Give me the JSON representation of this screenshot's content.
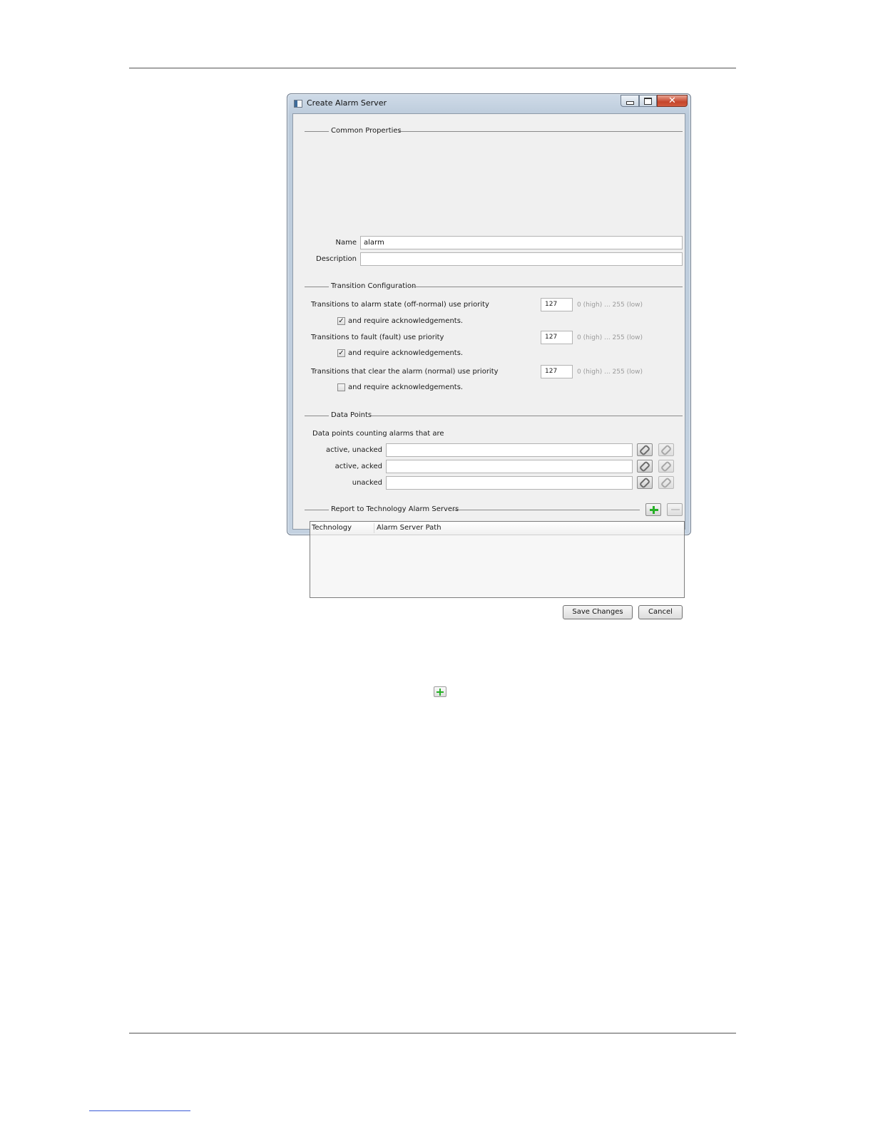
{
  "window": {
    "title": "Create Alarm Server",
    "close_glyph": "✕"
  },
  "common": {
    "heading": "Common Properties",
    "name_label": "Name",
    "name_value": "alarm",
    "description_label": "Description",
    "description_value": ""
  },
  "transition": {
    "heading": "Transition Configuration",
    "rows": [
      {
        "label": "Transitions to alarm state (off-normal) use priority",
        "priority": "127",
        "range_hint": "0 (high) ... 255 (low)",
        "ack_label": "and require acknowledgements.",
        "ack_checked": true,
        "ack_mark": "✓"
      },
      {
        "label": "Transitions to fault (fault) use priority",
        "priority": "127",
        "range_hint": "0 (high) ... 255 (low)",
        "ack_label": "and require acknowledgements.",
        "ack_checked": true,
        "ack_mark": "✓"
      },
      {
        "label": "Transitions that clear the alarm (normal) use priority",
        "priority": "127",
        "range_hint": "0 (high) ... 255 (low)",
        "ack_label": "and require acknowledgements.",
        "ack_checked": false,
        "ack_mark": ""
      }
    ]
  },
  "data_points": {
    "heading": "Data Points",
    "intro": "Data points counting alarms that are",
    "rows": [
      {
        "label": "active, unacked",
        "value": ""
      },
      {
        "label": "active, acked",
        "value": ""
      },
      {
        "label": "unacked",
        "value": ""
      }
    ]
  },
  "report": {
    "heading": "Report to Technology Alarm Servers",
    "columns": [
      "Technology",
      "Alarm Server Path"
    ],
    "rows": []
  },
  "footer": {
    "save_label": "Save Changes",
    "cancel_label": "Cancel"
  },
  "colors": {
    "plus_icon": "#27b027",
    "close_button": "#c5452b"
  },
  "icons": [
    "link-icon",
    "unlink-icon",
    "add-icon",
    "remove-icon",
    "window-icon",
    "minimize-icon",
    "maximize-icon",
    "close-icon"
  ]
}
